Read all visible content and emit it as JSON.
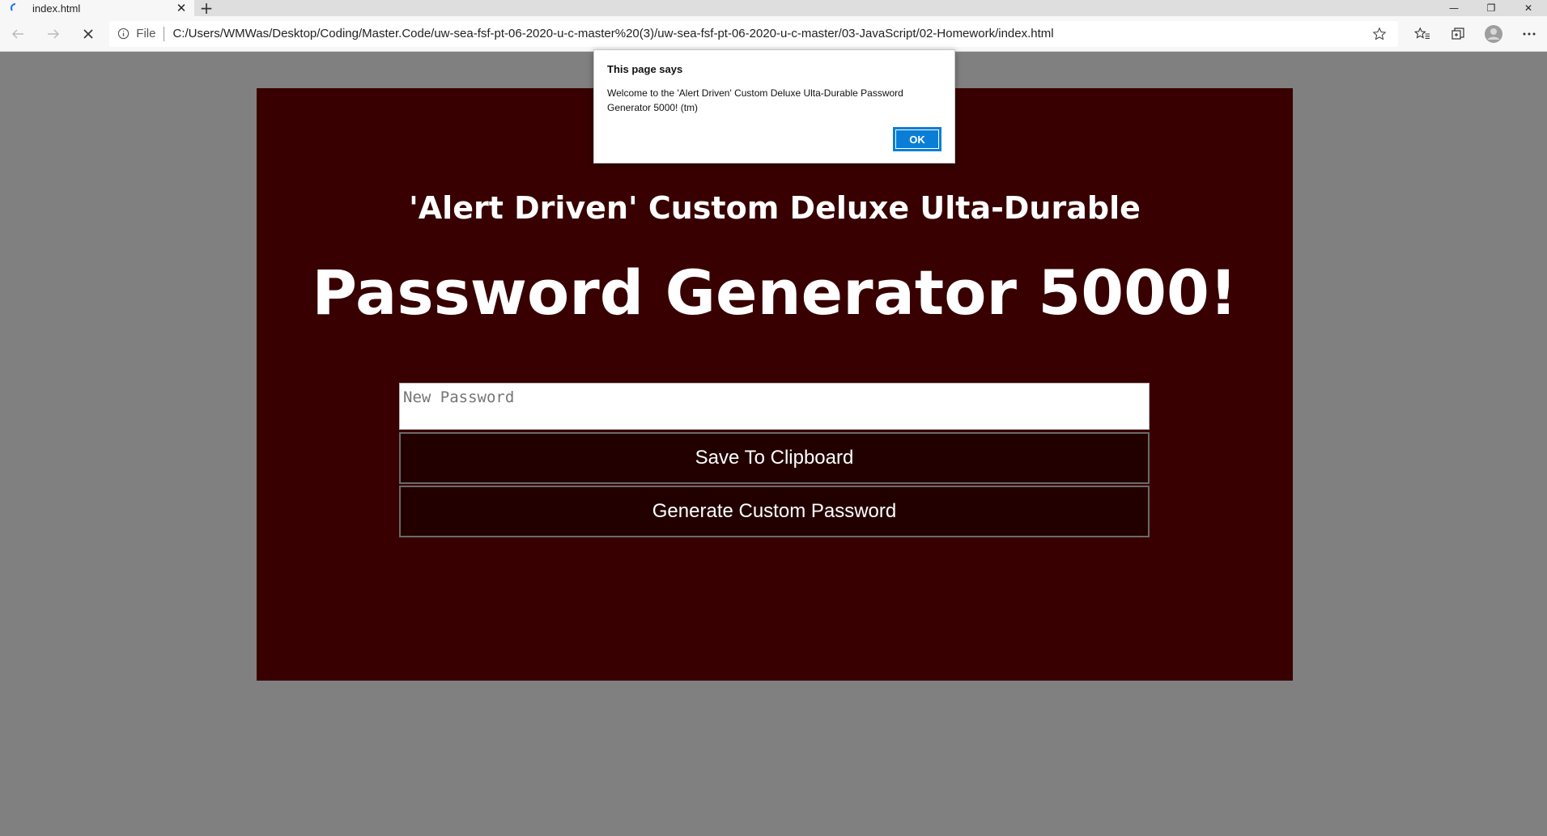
{
  "browser": {
    "tab": {
      "title": "index.html"
    },
    "address": {
      "scheme_label": "File",
      "url": "C:/Users/WMWas/Desktop/Coding/Master.Code/uw-sea-fsf-pt-06-2020-u-c-master%20(3)/uw-sea-fsf-pt-06-2020-u-c-master/03-JavaScript/02-Homework/index.html"
    },
    "colors": {
      "chrome": "#f7f7f7",
      "tabstrip": "#dedede"
    }
  },
  "page": {
    "subtitle": "'Alert Driven' Custom Deluxe Ulta-Durable",
    "title": "Password Generator 5000!",
    "password_placeholder": "New Password",
    "save_button": "Save To Clipboard",
    "generate_button": "Generate Custom Password",
    "colors": {
      "background": "#808080",
      "card": "#380000",
      "button": "#220000"
    }
  },
  "dialog": {
    "title": "This page says",
    "message": "Welcome to the 'Alert Driven' Custom Deluxe Ulta-Durable Password Generator 5000! (tm)",
    "ok_label": "OK",
    "colors": {
      "ok": "#0a7ed6"
    }
  }
}
